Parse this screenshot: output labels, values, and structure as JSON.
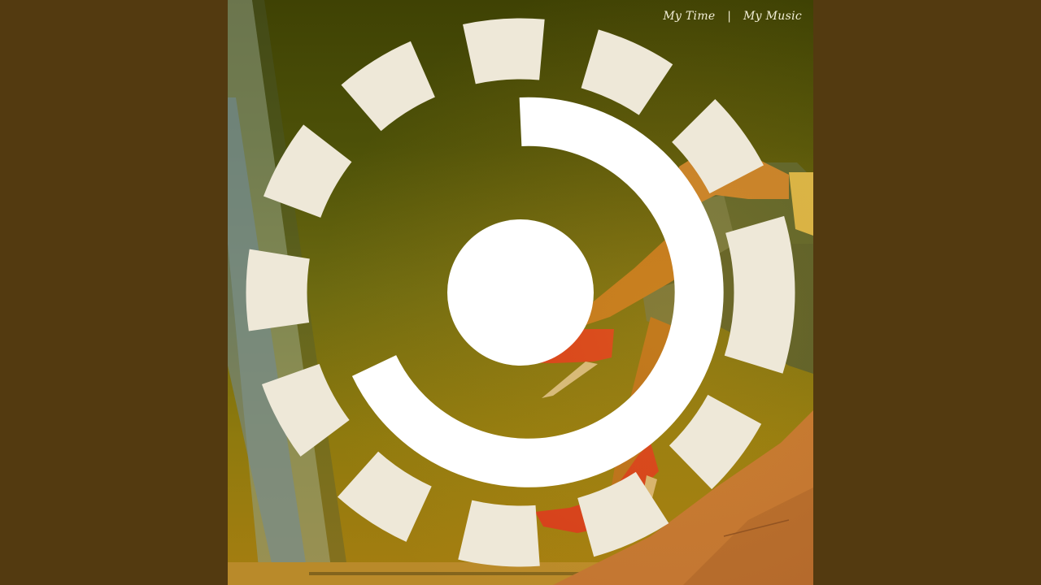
{
  "cover": {
    "label_left": "My Time",
    "separator": "|",
    "label_right": "My Music",
    "logo_icon": "swirl-logo-icon"
  },
  "colors": {
    "side_background": "#533a10",
    "sky_top": "#3f4204",
    "sky_bottom": "#a67e10",
    "shoe": "#d9381c",
    "skin": "#c77a24",
    "jeans": "#56602a",
    "rock": "#c9782e"
  }
}
